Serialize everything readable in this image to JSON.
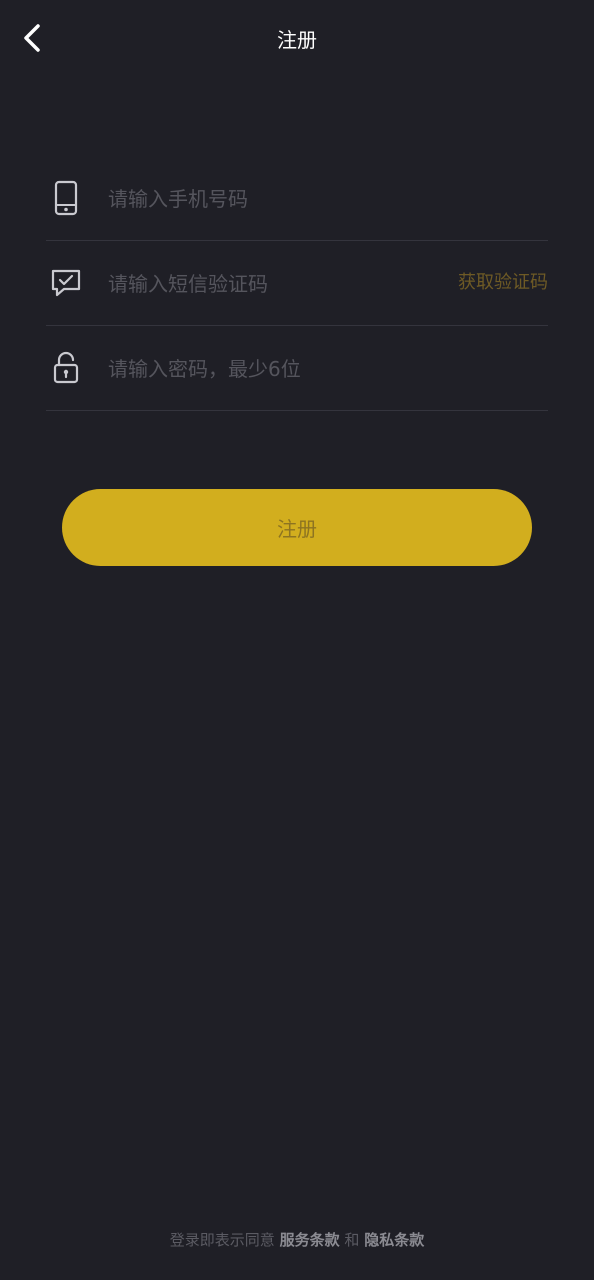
{
  "header": {
    "title": "注册",
    "back_icon": "back-arrow-icon"
  },
  "form": {
    "phone": {
      "icon": "mobile-phone-icon",
      "placeholder": "请输入手机号码",
      "value": ""
    },
    "sms": {
      "icon": "message-check-icon",
      "placeholder": "请输入短信验证码",
      "value": "",
      "action_label": "获取验证码"
    },
    "password": {
      "icon": "unlock-icon",
      "placeholder": "请输入密码，最少6位",
      "value": ""
    }
  },
  "submit": {
    "label": "注册"
  },
  "footer": {
    "prefix": "登录即表示同意",
    "terms_link": "服务条款",
    "connector": "和",
    "privacy_link": "隐私条款"
  },
  "colors": {
    "background": "#1f1f26",
    "accent": "#d2ae1e",
    "accent_text": "#8d7421",
    "divider": "#34343d",
    "placeholder": "#55555d"
  }
}
